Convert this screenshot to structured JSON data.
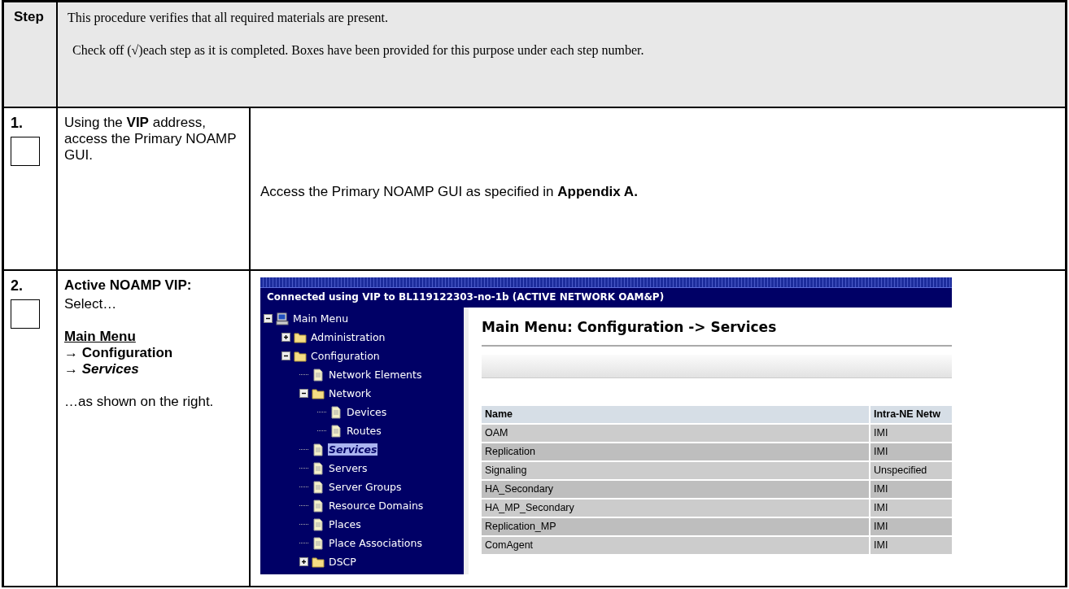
{
  "header": {
    "step_label": "Step",
    "paragraphs": [
      "This procedure verifies that all required materials are present.",
      "Check off (√)each step as it is completed. Boxes have been provided for this purpose under each step number."
    ]
  },
  "steps": [
    {
      "number": "1.",
      "checked": false,
      "instruction_lines": [
        {
          "kind": "plain",
          "text": "Using the **VIP** address, access the Primary NOAMP GUI."
        }
      ],
      "detail": {
        "kind": "text",
        "text": "Access the Primary NOAMP GUI as specified in **Appendix A.**"
      }
    },
    {
      "number": "2.",
      "checked": false,
      "instruction_lines": [
        {
          "kind": "heading",
          "text": "Active NOAMP VIP:"
        },
        {
          "kind": "plain",
          "text": "Select…"
        },
        {
          "kind": "gap"
        },
        {
          "kind": "link",
          "text": "Main Menu"
        },
        {
          "kind": "bold",
          "text": "→ Configuration"
        },
        {
          "kind": "bold",
          "text": "→ *Services*"
        },
        {
          "kind": "gap"
        },
        {
          "kind": "plain",
          "text": "…as shown on the right."
        }
      ],
      "detail": {
        "kind": "screenshot",
        "banner": "Connected using VIP to BL119122303-no-1b (ACTIVE NETWORK OAM&P)",
        "tree": [
          {
            "label": "Main Menu",
            "kind": "computer",
            "expanded": true,
            "selected": false,
            "children": [
              {
                "label": "Administration",
                "kind": "folder",
                "expanded": false,
                "selected": false
              },
              {
                "label": "Configuration",
                "kind": "folder",
                "expanded": true,
                "selected": false,
                "children": [
                  {
                    "label": "Network Elements",
                    "kind": "page",
                    "selected": false
                  },
                  {
                    "label": "Network",
                    "kind": "folder",
                    "expanded": true,
                    "selected": false,
                    "children": [
                      {
                        "label": "Devices",
                        "kind": "page",
                        "selected": false
                      },
                      {
                        "label": "Routes",
                        "kind": "page",
                        "selected": false
                      }
                    ]
                  },
                  {
                    "label": "Services",
                    "kind": "page",
                    "selected": true
                  },
                  {
                    "label": "Servers",
                    "kind": "page",
                    "selected": false
                  },
                  {
                    "label": "Server Groups",
                    "kind": "page",
                    "selected": false
                  },
                  {
                    "label": "Resource Domains",
                    "kind": "page",
                    "selected": false
                  },
                  {
                    "label": "Places",
                    "kind": "page",
                    "selected": false
                  },
                  {
                    "label": "Place Associations",
                    "kind": "page",
                    "selected": false
                  },
                  {
                    "label": "DSCP",
                    "kind": "folder",
                    "expanded": false,
                    "selected": false
                  }
                ]
              }
            ]
          }
        ],
        "page_title": "Main Menu: Configuration -> Services",
        "table": {
          "columns": [
            "Name",
            "Intra-NE Netw"
          ],
          "rows": [
            [
              "OAM",
              "IMI"
            ],
            [
              "Replication",
              "IMI"
            ],
            [
              "Signaling",
              "Unspecified"
            ],
            [
              "HA_Secondary",
              "IMI"
            ],
            [
              "HA_MP_Secondary",
              "IMI"
            ],
            [
              "Replication_MP",
              "IMI"
            ],
            [
              "ComAgent",
              "IMI"
            ]
          ]
        }
      }
    }
  ]
}
